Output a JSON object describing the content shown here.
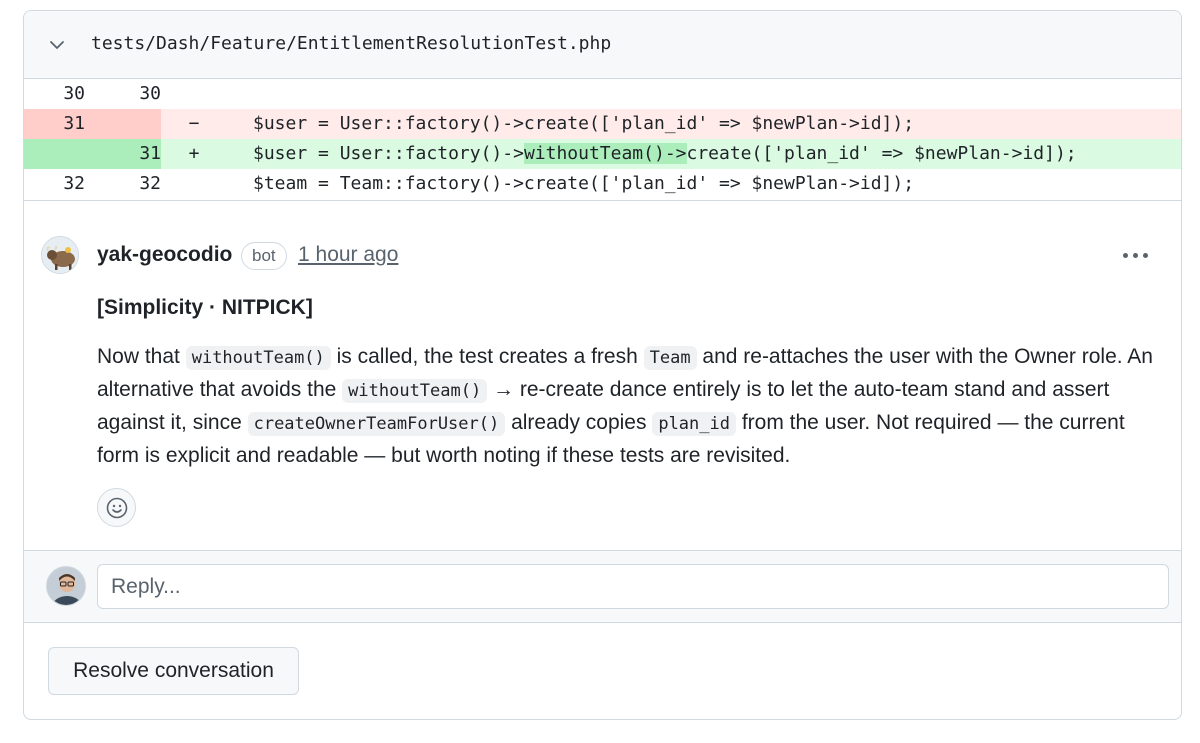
{
  "file": {
    "path": "tests/Dash/Feature/EntitlementResolutionTest.php",
    "collapse_icon": "chevron-down-icon"
  },
  "diff": {
    "lines": [
      {
        "type": "context",
        "old": "30",
        "new": "30",
        "sign": "",
        "code_before": "",
        "code_highlight": "",
        "code_after": ""
      },
      {
        "type": "deletion",
        "old": "31",
        "new": "",
        "sign": "−",
        "code_before": "$user = User::factory()->create(['plan_id' => $newPlan->id]);",
        "code_highlight": "",
        "code_after": ""
      },
      {
        "type": "addition",
        "old": "",
        "new": "31",
        "sign": "+",
        "code_before": "$user = User::factory()->",
        "code_highlight": "withoutTeam()->",
        "code_after": "create(['plan_id' => $newPlan->id]);"
      },
      {
        "type": "context",
        "old": "32",
        "new": "32",
        "sign": "",
        "code_before": "$team = Team::factory()->create(['plan_id' => $newPlan->id]);",
        "code_highlight": "",
        "code_after": ""
      }
    ]
  },
  "comment": {
    "author": "yak-geocodio",
    "badge": "bot",
    "time": "1 hour ago",
    "tag": "[Simplicity · NITPICK]",
    "body": {
      "t1": "Now that ",
      "c1": "withoutTeam()",
      "t2": " is called, the test creates a fresh ",
      "c2": "Team",
      "t3": " and re-attaches the user with the Owner role. An alternative that avoids the ",
      "c3": "withoutTeam()",
      "t4": " → re-create dance entirely is to let the auto-team stand and assert against it, since ",
      "c4": "createOwnerTeamForUser()",
      "t5": " already copies ",
      "c5": "plan_id",
      "t6": " from the user. Not required — the current form is explicit and readable — but worth noting if these tests are revisited."
    },
    "menu_icon": "kebab-horizontal-icon",
    "reaction_icon": "smiley-icon"
  },
  "reply": {
    "placeholder": "Reply..."
  },
  "actions": {
    "resolve_label": "Resolve conversation"
  },
  "colors": {
    "border": "#d1d9e0",
    "deletion_bg": "#ffebe9",
    "deletion_num_bg": "#ffcecb",
    "addition_bg": "#dafbe1",
    "addition_num_bg": "#aceebb",
    "muted_text": "#59636e"
  }
}
